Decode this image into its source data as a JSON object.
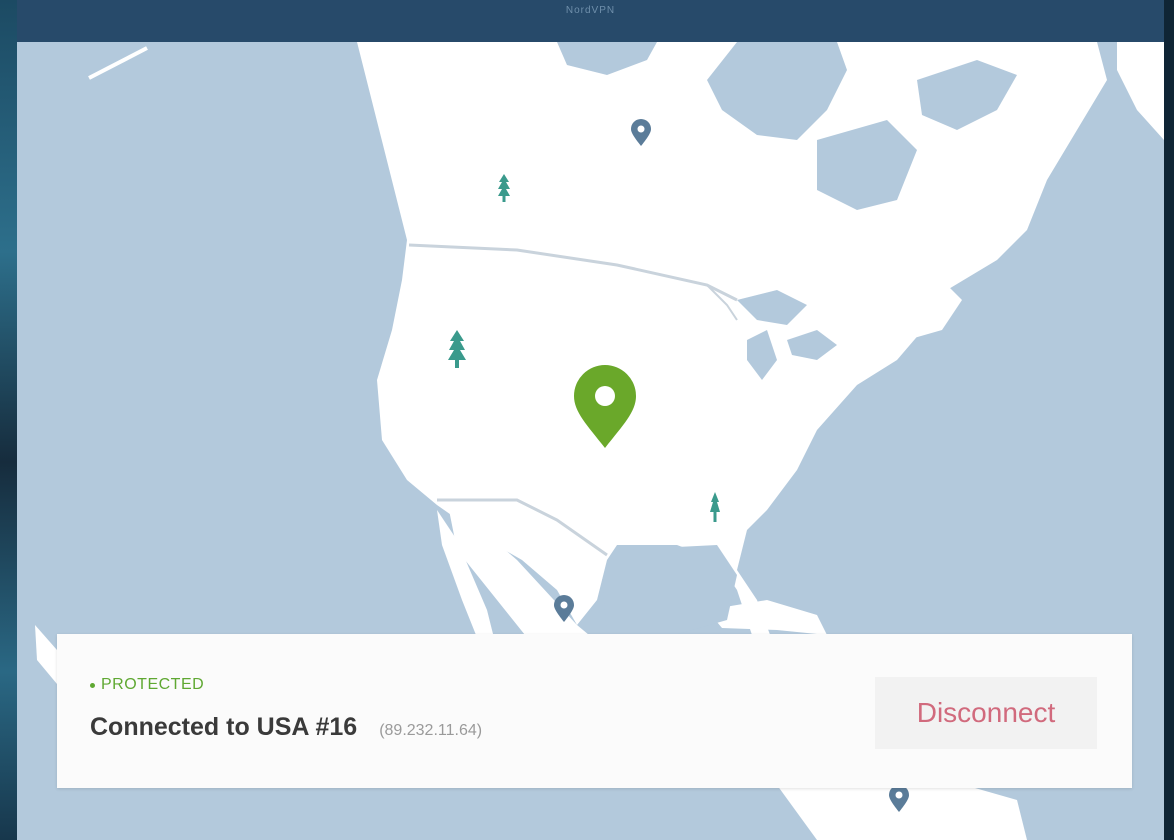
{
  "window": {
    "title": "NordVPN"
  },
  "status": {
    "label": "PROTECTED",
    "connection_text": "Connected to USA #16",
    "ip_text": "(89.232.11.64)",
    "disconnect_label": "Disconnect"
  },
  "colors": {
    "ocean": "#b3c9dc",
    "land": "#ffffff",
    "titlebar": "#274a6a",
    "protected_green": "#5fa832",
    "server_pin": "#5b7c99",
    "tree": "#3a9a8c",
    "disconnect_text": "#d16a7d"
  },
  "map": {
    "active_pin_icon": "location-pin-active-icon",
    "server_pin_icon": "location-pin-icon",
    "tree_icon": "tree-icon"
  }
}
